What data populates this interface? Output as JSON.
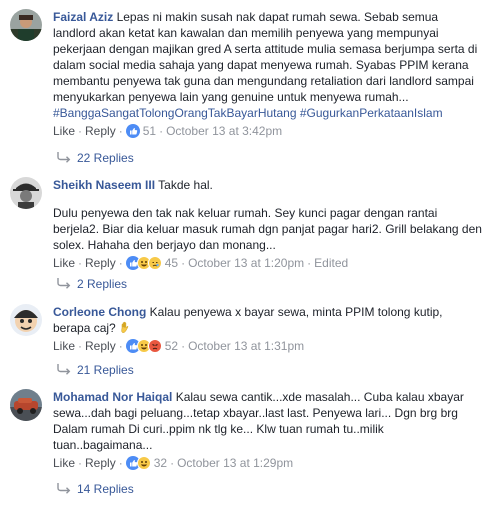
{
  "actions": {
    "like": "Like",
    "reply": "Reply",
    "dot": "·"
  },
  "comments": [
    {
      "name": "Faizal Aziz",
      "text": "Lepas ni makin susah nak dapat rumah sewa. Sebab semua landlord akan ketat kan kawalan dan memilih penyewa yang mempunyai pekerjaan dengan majikan gred A serta attitude mulia semasa berjumpa serta di dalam social media sahaja yang dapat menyewa rumah. Syabas PPIM kerana membantu penyewa tak guna dan mengundang retaliation dari landlord sampai menyukarkan penyewa lain yang genuine untuk menyewa rumah...",
      "tags": "#BanggaSangatTolongOrangTakBayarHutang #GugurkanPerkataanIslam",
      "reactions": "51",
      "time": "October 13 at 3:42pm",
      "replies": "22 Replies"
    },
    {
      "name": "Sheikh Naseem III",
      "text": "Takde hal.",
      "text2": "Dulu penyewa den tak nak keluar rumah. Sey kunci pagar dengan rantai berjela2. Biar dia keluar masuk rumah dgn panjat pagar hari2. Grill belakang den solex. Hahaha den berjayo dan monang...",
      "reactions": "45",
      "time": "October 13 at 1:20pm",
      "edited": "Edited",
      "replies": "2 Replies"
    },
    {
      "name": "Corleone Chong",
      "text": "Kalau penyewa x bayar sewa, minta PPIM tolong kutip, berapa caj?",
      "reactions": "52",
      "time": "October 13 at 1:31pm",
      "replies": "21 Replies"
    },
    {
      "name": "Mohamad Nor Haiqal",
      "text": "Kalau sewa cantik...xde masalah... Cuba kalau xbayar sewa...dah bagi peluang...tetap xbayar..last last. Penyewa lari... Dgn brg brg Dalam rumah Di curi..ppim nk tlg ke... Klw tuan rumah tu..milik tuan..bagaimana...",
      "reactions": "32",
      "time": "October 13 at 1:29pm",
      "replies": "14 Replies"
    }
  ]
}
